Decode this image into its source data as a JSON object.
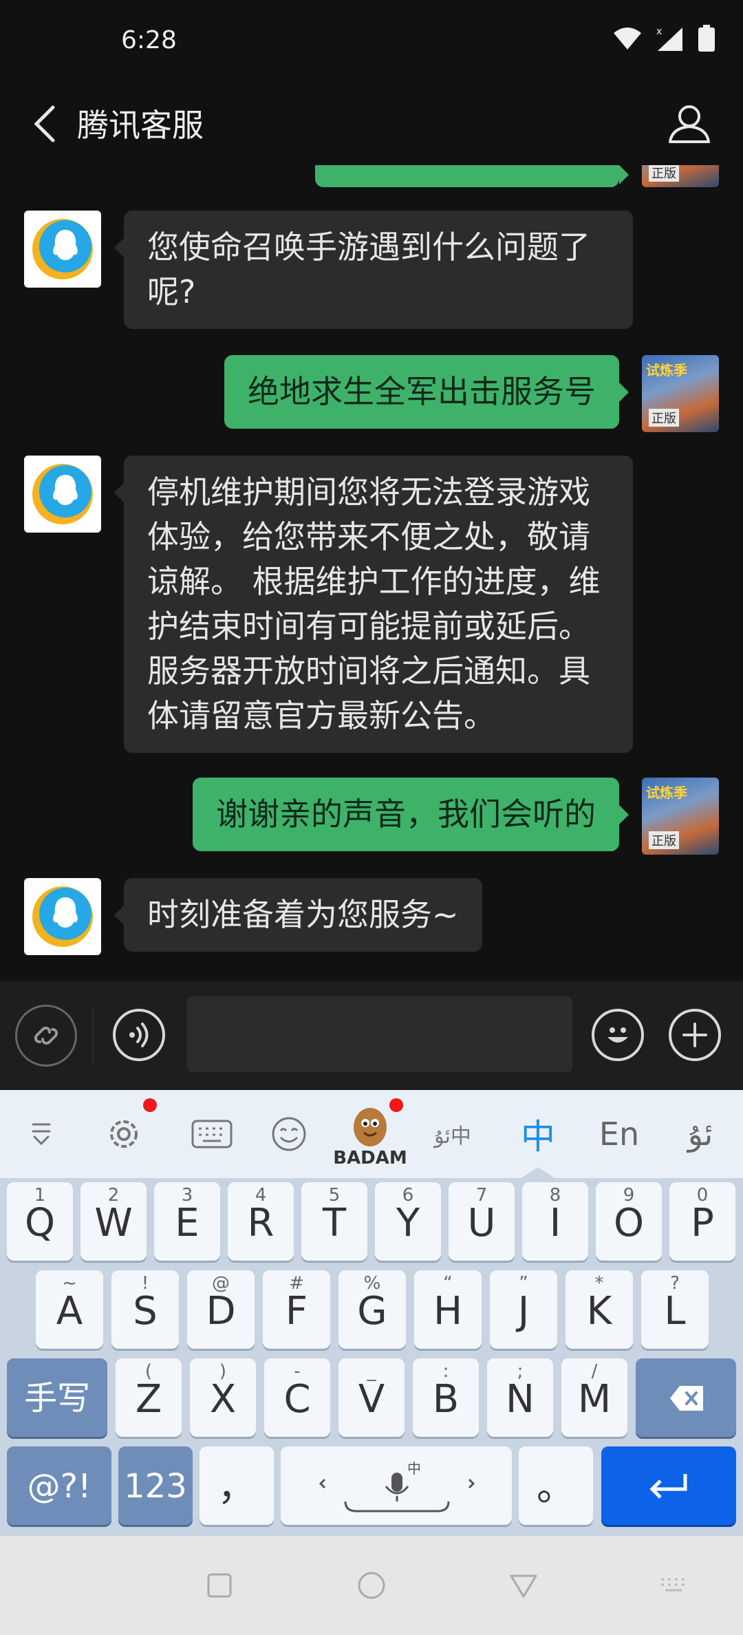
{
  "status_bar": {
    "time": "6:28"
  },
  "header": {
    "title": "腾讯客服"
  },
  "messages": [
    {
      "from": "bot",
      "text": "您使命召唤手游遇到什么问题了呢?"
    },
    {
      "from": "user",
      "text": "绝地求生全军出击服务号"
    },
    {
      "from": "bot",
      "text": "停机维护期间您将无法登录游戏体验，给您带来不便之处，敬请谅解。 根据维护工作的进度，维护结束时间有可能提前或延后。服务器开放时间将之后通知。具体请留意官方最新公告。"
    },
    {
      "from": "user",
      "text": "谢谢亲的声音，我们会听的"
    },
    {
      "from": "bot",
      "text": "时刻准备着为您服务~"
    }
  ],
  "avatar": {
    "user_badge": "正版",
    "user_banner": "试炼季"
  },
  "ime_toolbar": {
    "logo_text": "BADAM",
    "chinese": "中",
    "english": "En",
    "uyghur": "ئۇ",
    "switch_label": "ئۇ中"
  },
  "keyboard": {
    "row1": [
      {
        "main": "Q",
        "sub": "1"
      },
      {
        "main": "W",
        "sub": "2"
      },
      {
        "main": "E",
        "sub": "3"
      },
      {
        "main": "R",
        "sub": "4"
      },
      {
        "main": "T",
        "sub": "5"
      },
      {
        "main": "Y",
        "sub": "6"
      },
      {
        "main": "U",
        "sub": "7"
      },
      {
        "main": "I",
        "sub": "8"
      },
      {
        "main": "O",
        "sub": "9"
      },
      {
        "main": "P",
        "sub": "0"
      }
    ],
    "row2": [
      {
        "main": "A",
        "sub": "~"
      },
      {
        "main": "S",
        "sub": "!"
      },
      {
        "main": "D",
        "sub": "@"
      },
      {
        "main": "F",
        "sub": "#"
      },
      {
        "main": "G",
        "sub": "%"
      },
      {
        "main": "H",
        "sub": "“"
      },
      {
        "main": "J",
        "sub": "”"
      },
      {
        "main": "K",
        "sub": "*"
      },
      {
        "main": "L",
        "sub": "?"
      }
    ],
    "row3": [
      {
        "main": "Z",
        "sub": "("
      },
      {
        "main": "X",
        "sub": ")"
      },
      {
        "main": "C",
        "sub": "-"
      },
      {
        "main": "V",
        "sub": "_"
      },
      {
        "main": "B",
        "sub": ":"
      },
      {
        "main": "N",
        "sub": ";"
      },
      {
        "main": "M",
        "sub": "/"
      }
    ],
    "handwrite": "手写",
    "symbols": "@?!",
    "numbers": "123",
    "comma": "，",
    "space_hint": "中",
    "period": "。"
  },
  "colors": {
    "background": "#111111",
    "bot_bubble": "#2c2c2c",
    "user_bubble": "#3fb26a",
    "enter_key": "#0c63e7",
    "ime_active": "#1a8ee8"
  }
}
